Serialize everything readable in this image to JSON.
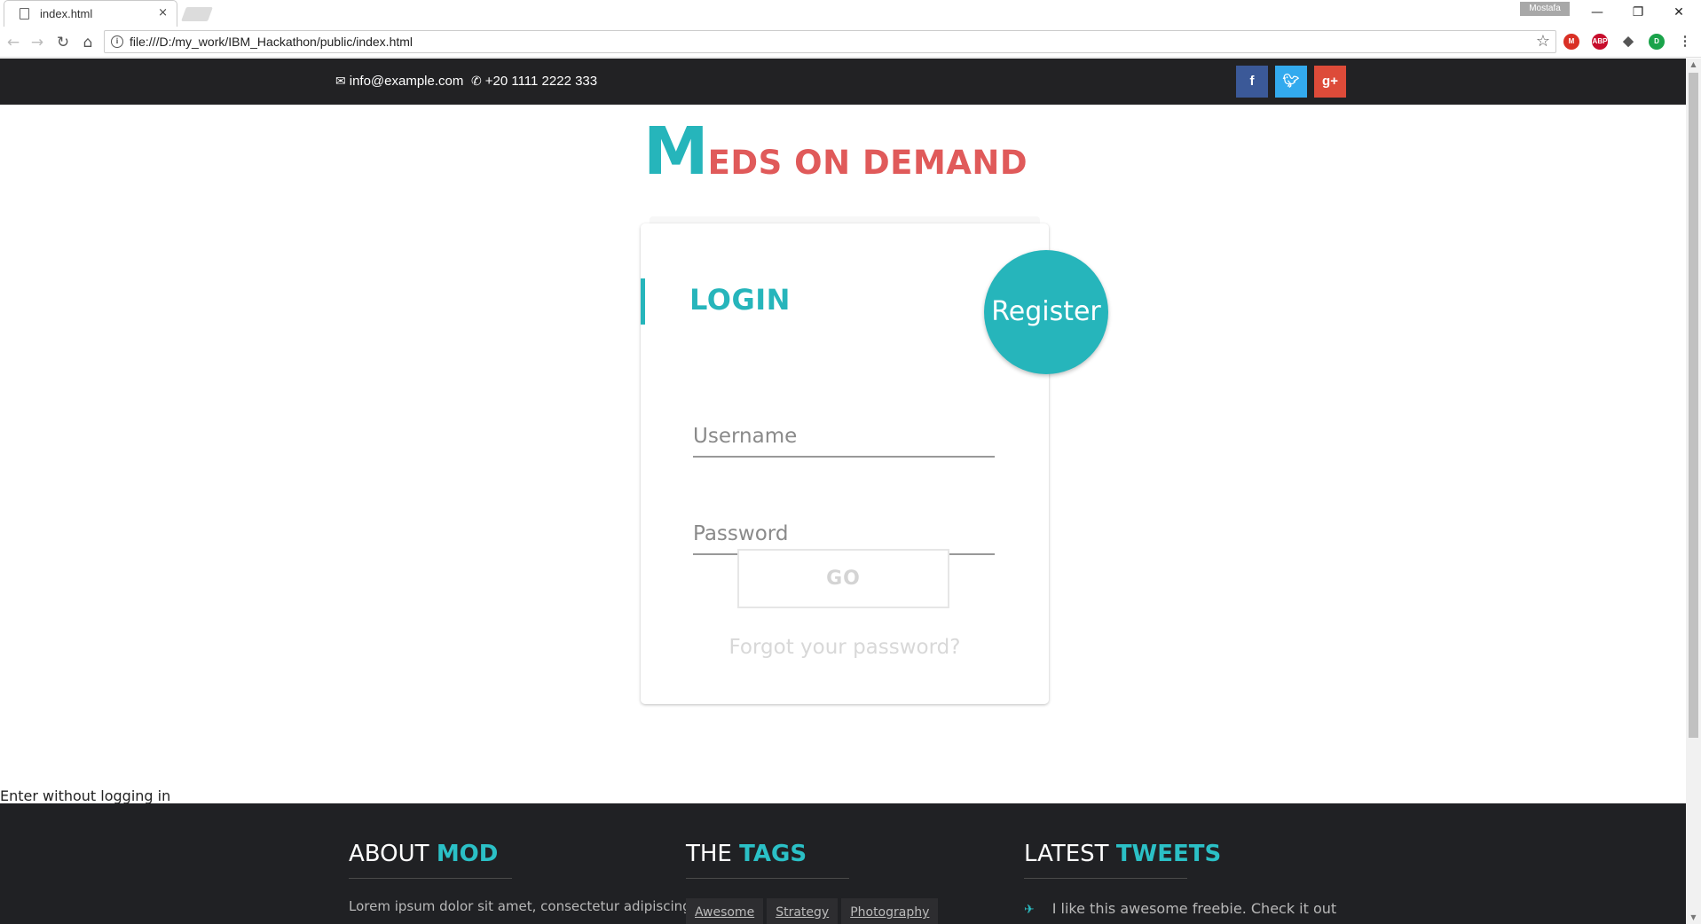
{
  "browser": {
    "tab_title": "index.html",
    "tab_close": "×",
    "user_badge": "Mostafa",
    "window_controls": {
      "minimize": "—",
      "restore": "❐",
      "close": "✕"
    },
    "nav": {
      "back": "←",
      "forward": "→",
      "reload": "↻",
      "home": "⌂"
    },
    "url": "file:///D:/my_work/IBM_Hackathon/public/index.html",
    "extensions": [
      {
        "name": "gmail-extension-icon",
        "label": "M",
        "color": "#d93025"
      },
      {
        "name": "adblock-plus-icon",
        "label": "ABP",
        "color": "#c70d2c"
      },
      {
        "name": "pocket-icon",
        "label": "◆",
        "color": "#555555"
      },
      {
        "name": "green-extension-icon",
        "label": "D",
        "color": "#1aa34a"
      },
      {
        "name": "menu-icon",
        "label": "⋮",
        "color": "#555555"
      }
    ]
  },
  "topbar": {
    "email": "info@example.com",
    "phone": "+20 1111 2222 333",
    "email_icon": "✉",
    "phone_icon": "✆",
    "social": [
      {
        "name": "facebook",
        "glyph": "f",
        "color": "#3b5998"
      },
      {
        "name": "twitter",
        "glyph": "🐦︎",
        "color": "#33aaee"
      },
      {
        "name": "google-plus",
        "glyph": "g+",
        "color": "#dd4b39"
      }
    ]
  },
  "logo": {
    "initial": "M",
    "rest": "EDS ON DEMAND"
  },
  "login": {
    "title": "LOGIN",
    "username_placeholder": "Username",
    "password_placeholder": "Password",
    "submit_label": "GO",
    "forgot_link": "Forgot your password?"
  },
  "register_label": "Register",
  "enter_without_login": "Enter without logging in",
  "footer": {
    "about": {
      "prefix": "ABOUT",
      "highlight": "MOD",
      "text": "Lorem ipsum dolor sit amet, consectetur adipiscing"
    },
    "tags": {
      "prefix": "THE",
      "highlight": "TAGS",
      "items": [
        "Awesome",
        "Strategy",
        "Photography"
      ]
    },
    "tweets": {
      "prefix": "LATEST",
      "highlight": "TWEETS",
      "first_tweet": "I like this awesome freebie. Check it out"
    }
  },
  "colors": {
    "accent": "#26b5bb",
    "logo_red": "#e05a5a",
    "topbar": "#222224",
    "footer": "#202124"
  }
}
